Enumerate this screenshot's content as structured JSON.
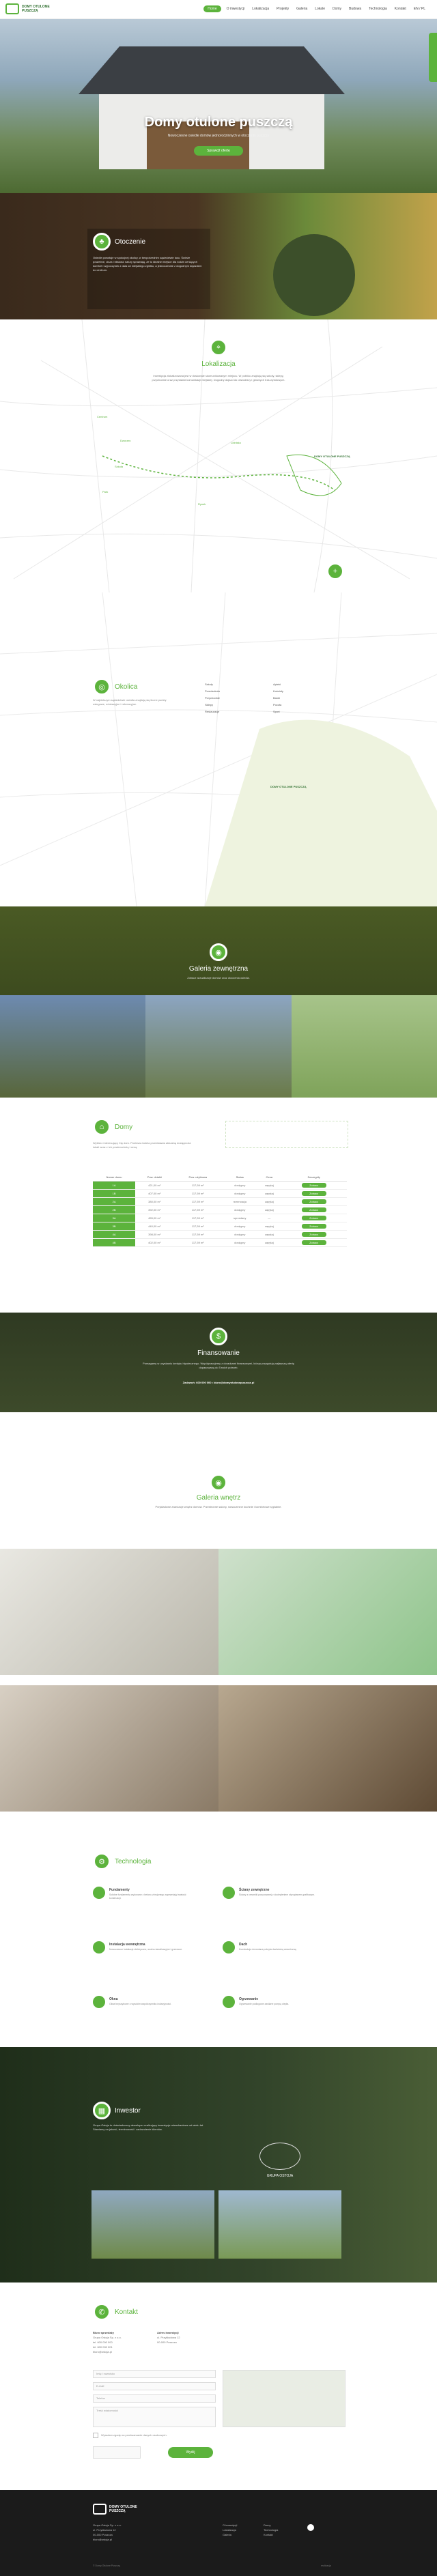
{
  "header": {
    "logo_line1": "DOMY OTULONE",
    "logo_line2": "PUSZCZĄ",
    "nav": [
      "Home",
      "O inwestycji",
      "Lokalizacja",
      "Projekty",
      "Galeria",
      "Lokale",
      "Domy",
      "Budowa",
      "Technologia",
      "Kontakt",
      "EN / PL"
    ]
  },
  "hero": {
    "title": "Domy otulone puszczą",
    "subtitle": "Nowoczesne osiedle domów jednorodzinnych w otoczeniu puszczy",
    "button": "Sprawdź ofertę"
  },
  "okolica": {
    "title": "Otoczenie",
    "text": "Osiedle powstaje w spokojnej okolicy, w bezpośrednim sąsiedztwie lasu. Świeże powietrze, cisza i bliskość natury sprawiają, że to idealne miejsce dla rodzin ceniących komfort i wypoczynek z dala od miejskiego zgiełku, a jednocześnie z dogodnym dojazdem do centrum."
  },
  "lokalizacja": {
    "title": "Lokalizacja",
    "text": "Inwestycja zlokalizowana jest w doskonale skomunikowanym miejscu. W pobliżu znajdują się szkoły, sklepy, przychodnie oraz przystanki komunikacji miejskiej. Dogodny dojazd do obwodnicy i głównych tras wylotowych.",
    "markers": [
      "Centrum",
      "Dworzec",
      "Lotnisko",
      "Szkoła",
      "Rynek",
      "Park"
    ],
    "dest": "DOMY OTULONE PUSZCZĄ"
  },
  "okolica2": {
    "title": "Okolica",
    "text": "W najbliższym sąsiedztwie osiedla znajdują się liczne punkty usługowe, edukacyjne i rekreacyjne.",
    "legend": [
      "Szkoły",
      "Przedszkola",
      "Przychodnie",
      "Sklepy",
      "Restauracje",
      "Apteki",
      "Kościoły",
      "Banki",
      "Poczta",
      "Sport"
    ],
    "dest": "DOMY OTULONE PUSZCZĄ"
  },
  "galeria_z": {
    "title": "Galeria zewnętrzna",
    "text": "Zobacz wizualizacje domów oraz otoczenia osiedla."
  },
  "domy": {
    "title": "Domy",
    "text": "Wybierz interesujący Cię dom. Poniższa tabela przedstawia aktualną dostępność lokali wraz z ich powierzchnią i ceną.",
    "columns": [
      "Numer domu",
      "Pow. działki",
      "Pow. użytkowa",
      "Status",
      "Cena",
      "Szczegóły"
    ],
    "rows": [
      [
        "1A",
        "421,00 m²",
        "117,59 m²",
        "dostępny",
        "zapytaj",
        ""
      ],
      [
        "1B",
        "407,00 m²",
        "117,59 m²",
        "dostępny",
        "zapytaj",
        ""
      ],
      [
        "2A",
        "380,00 m²",
        "117,59 m²",
        "rezerwacja",
        "zapytaj",
        ""
      ],
      [
        "2B",
        "392,00 m²",
        "117,59 m²",
        "dostępny",
        "zapytaj",
        ""
      ],
      [
        "3A",
        "455,00 m²",
        "117,59 m²",
        "sprzedany",
        "—",
        ""
      ],
      [
        "3B",
        "440,00 m²",
        "117,59 m²",
        "dostępny",
        "zapytaj",
        ""
      ],
      [
        "4A",
        "398,00 m²",
        "117,59 m²",
        "dostępny",
        "zapytaj",
        ""
      ],
      [
        "4B",
        "402,00 m²",
        "117,59 m²",
        "dostępny",
        "zapytaj",
        ""
      ]
    ],
    "detail_button": "Zobacz"
  },
  "finansowanie": {
    "title": "Finansowanie",
    "text": "Pomagamy w uzyskaniu kredytu hipotecznego. Współpracujemy z doradcami finansowymi, którzy przygotują najlepszą ofertę dopasowaną do Twoich potrzeb.",
    "contact": "Zadzwoń: 600 000 000 • biuro@domyotulonepuszcza.pl"
  },
  "galeria_w": {
    "title": "Galeria wnętrz",
    "text": "Przykładowe aranżacje wnętrz domów. Przestronne salony, nowoczesne kuchnie i komfortowe sypialnie."
  },
  "technologia": {
    "title": "Technologia",
    "items": [
      {
        "title": "Fundamenty",
        "text": "Solidne fundamenty wykonane z betonu zbrojonego zapewniają trwałość konstrukcji."
      },
      {
        "title": "Ściany zewnętrzne",
        "text": "Ściany z ceramiki poryzowanej z dociepleniem styropianem grafitowym."
      },
      {
        "title": "Instalacja wewnętrzna",
        "text": "Nowoczesne instalacje elektryczne, wodno-kanalizacyjne i grzewcze."
      },
      {
        "title": "Dach",
        "text": "Konstrukcja drewniana pokryta dachówką ceramiczną."
      },
      {
        "title": "Okna",
        "text": "Okna trzyszybowe o wysokim współczynniku izolacyjności."
      },
      {
        "title": "Ogrzewanie",
        "text": "Ogrzewanie podłogowe zasilane pompą ciepła."
      }
    ]
  },
  "inwestor": {
    "title": "Inwestor",
    "text": "Grupa Ostoja to doświadczony deweloper realizujący inwestycje mieszkaniowe od wielu lat. Stawiamy na jakość, terminowość i zadowolenie klientów.",
    "brand": "GRUPA OSTOJA"
  },
  "kontakt": {
    "title": "Kontakt",
    "office_label": "Biuro sprzedaży",
    "office_lines": [
      "Grupa Ostoja Sp. z o.o.",
      "tel. 600 000 000",
      "tel. 600 000 001",
      "biuro@ostoja.pl"
    ],
    "address_label": "Adres inwestycji",
    "address_lines": [
      "ul. Przykładowa 12",
      "00-000 Puszcza"
    ],
    "fields": [
      "Imię i nazwisko",
      "E-mail",
      "Telefon",
      "Treść wiadomości"
    ],
    "consent": "Wyrażam zgodę na przetwarzanie danych osobowych.",
    "send": "Wyślij"
  },
  "footer": {
    "logo_line1": "DOMY OTULONE",
    "logo_line2": "PUSZCZĄ",
    "col1": [
      "Grupa Ostoja Sp. z o.o.",
      "ul. Przykładowa 12",
      "00-000 Puszcza",
      "biuro@ostoja.pl"
    ],
    "col2": [
      "O inwestycji",
      "Lokalizacja",
      "Galeria"
    ],
    "col3": [
      "Domy",
      "Technologia",
      "Kontakt"
    ],
    "copyright": "© Domy Otulone Puszczą",
    "credit": "realizacja"
  },
  "colors": {
    "accent": "#5cb33c",
    "dark": "#1b1b1b"
  }
}
